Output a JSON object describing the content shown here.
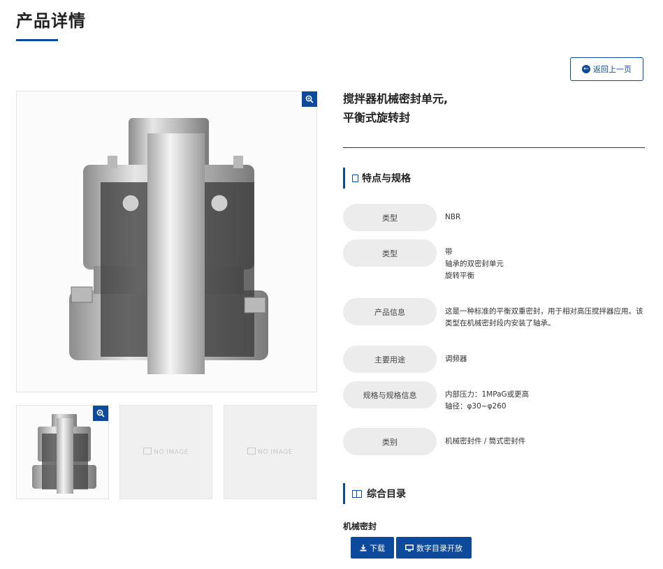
{
  "page": {
    "title": "产品详情"
  },
  "back_button": {
    "label": "返回上一页",
    "icon": "arrow-circle-left-icon"
  },
  "product": {
    "name_line1": "搅拌器机械密封单元,",
    "name_line2": "平衡式旋转封"
  },
  "gallery": {
    "no_image_text": "NO IMAGE",
    "zoom_icon": "zoom-in-icon"
  },
  "specs_section": {
    "title": "特点与规格",
    "icon": "document-icon"
  },
  "specs": [
    {
      "label": "类型",
      "value": "NBR"
    },
    {
      "label": "类型",
      "value_lines": [
        "带",
        "轴承的双密封单元",
        "旋转平衡"
      ]
    },
    {
      "label": "产品信息",
      "value": "这是一种标准的平衡双重密封，用于相对高压搅拌器应用。该类型在机械密封段内安装了轴承。"
    },
    {
      "label": "主要用途",
      "value": "调频器"
    },
    {
      "label": "规格与规格信息",
      "value_lines": [
        "内部压力：1MPaG或更高",
        "轴径：φ30~φ260"
      ]
    },
    {
      "label": "类别",
      "value": "机械密封件 / 筒式密封件"
    }
  ],
  "catalog_section": {
    "title": "综合目录",
    "icon": "book-icon"
  },
  "catalog": {
    "item_label": "机械密封",
    "download_label": "下载",
    "open_label": "数字目录开放"
  },
  "colors": {
    "accent": "#0e4a9c",
    "pill_bg": "#ececec"
  }
}
